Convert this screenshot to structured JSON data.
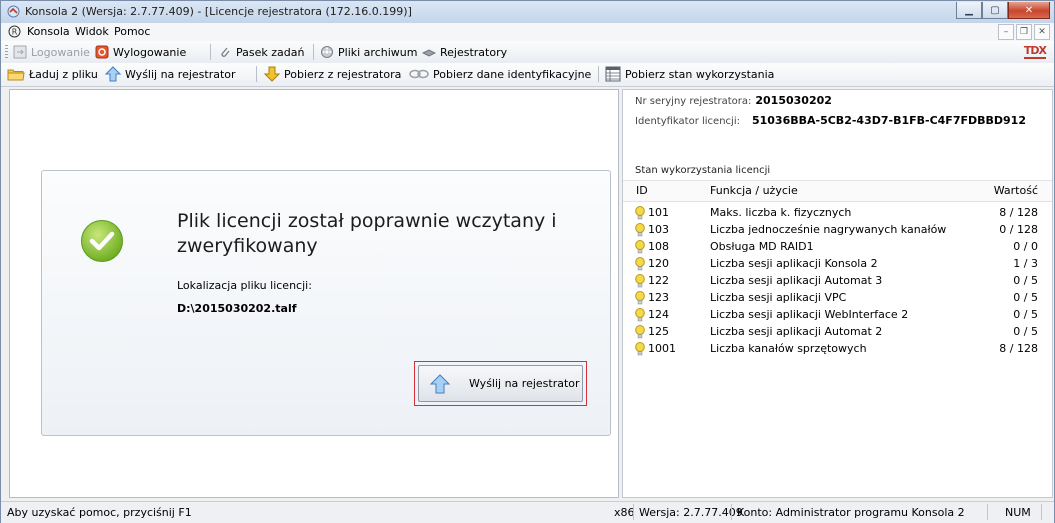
{
  "window": {
    "title": "Konsola 2 (Wersja: 2.7.77.409) - [Licencje rejestratora (172.16.0.199)]"
  },
  "menu": {
    "items": [
      "Konsola",
      "Widok",
      "Pomoc"
    ]
  },
  "toolbar1": {
    "login": "Logowanie",
    "logout": "Wylogowanie",
    "taskbar": "Pasek zadań",
    "archive": "Pliki archiwum",
    "recorders": "Rejestratory",
    "brand": "TDX"
  },
  "toolbar2": {
    "load": "Ładuj z pliku",
    "send": "Wyślij na rejestrator",
    "download": "Pobierz z rejestratora",
    "ident": "Pobierz dane identyfikacyjne",
    "usage": "Pobierz stan wykorzystania"
  },
  "left": {
    "message": "Plik licencji został poprawnie wczytany i zweryfikowany",
    "location_label": "Lokalizacja pliku licencji:",
    "location_path": "D:\\2015030202.talf",
    "send_button": "Wyślij na rejestrator"
  },
  "right": {
    "serial_label": "Nr seryjny rejestratora:",
    "serial_value": "2015030202",
    "license_id_label": "Identyfikator licencji:",
    "license_id_value": "51036BBA-5CB2-43D7-B1FB-C4F7FDBBD912",
    "usage_title": "Stan wykorzystania licencji",
    "columns": [
      "ID",
      "Funkcja / użycie",
      "Wartość"
    ],
    "rows": [
      {
        "id": "101",
        "fn": "Maks. liczba k. fizycznych",
        "val": "8 / 128"
      },
      {
        "id": "103",
        "fn": "Liczba jednocześnie nagrywanych kanałów",
        "val": "0 / 128"
      },
      {
        "id": "108",
        "fn": "Obsługa MD RAID1",
        "val": "0 / 0"
      },
      {
        "id": "120",
        "fn": "Liczba sesji aplikacji Konsola 2",
        "val": "1 / 3"
      },
      {
        "id": "122",
        "fn": "Liczba sesji aplikacji Automat 3",
        "val": "0 / 5"
      },
      {
        "id": "123",
        "fn": "Liczba sesji aplikacji VPC",
        "val": "0 / 5"
      },
      {
        "id": "124",
        "fn": "Liczba sesji aplikacji WebInterface 2",
        "val": "0 / 5"
      },
      {
        "id": "125",
        "fn": "Liczba sesji aplikacji Automat 2",
        "val": "0 / 5"
      },
      {
        "id": "1001",
        "fn": "Liczba kanałów sprzętowych",
        "val": "8 / 128"
      }
    ]
  },
  "status": {
    "help": "Aby uzyskać pomoc, przyciśnij F1",
    "arch": "x86",
    "version": "Wersja: 2.7.77.409",
    "account": "Konto: Administrator programu Konsola 2",
    "num": "NUM"
  },
  "colors": {
    "accent": "#2e7fd0",
    "check_green": "#8cc63f",
    "highlight_border": "#d6303b",
    "bulb": "#f2d23a"
  }
}
